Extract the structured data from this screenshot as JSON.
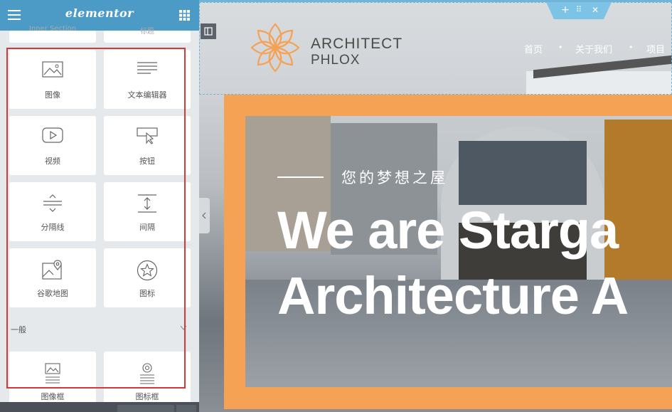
{
  "sidebar": {
    "brand": "elementor",
    "partial_top": [
      "Inner Section",
      "标题"
    ],
    "widgets": [
      {
        "label": "图像",
        "icon": "image-icon"
      },
      {
        "label": "文本编辑器",
        "icon": "text-editor-icon"
      },
      {
        "label": "视频",
        "icon": "video-icon"
      },
      {
        "label": "按钮",
        "icon": "button-icon"
      },
      {
        "label": "分隔线",
        "icon": "divider-icon"
      },
      {
        "label": "间隔",
        "icon": "spacer-icon"
      },
      {
        "label": "谷歌地图",
        "icon": "google-maps-icon"
      },
      {
        "label": "图标",
        "icon": "star-icon"
      }
    ],
    "section_title": "一般",
    "general_widgets": [
      {
        "label": "图像框",
        "icon": "image-box-icon"
      },
      {
        "label": "图标框",
        "icon": "icon-box-icon"
      }
    ],
    "highlight_color": "#d23a3a",
    "accent_color": "#4b9bc6"
  },
  "canvas": {
    "logo": {
      "line1": "ARCHITECT",
      "line2": "PHLOX",
      "icon": "lotus-logo-icon",
      "color": "#f5a255"
    },
    "nav": [
      "首页",
      "关于我们",
      "项目"
    ],
    "hero": {
      "tagline": "您的梦想之屋",
      "title_line1": "We are Starga",
      "title_line2": "Architecture A"
    },
    "section_tools": {
      "add": "+",
      "move": "⠿",
      "close": "✕"
    },
    "frame_color": "#f5a255",
    "selection_color": "#71b4d8"
  }
}
